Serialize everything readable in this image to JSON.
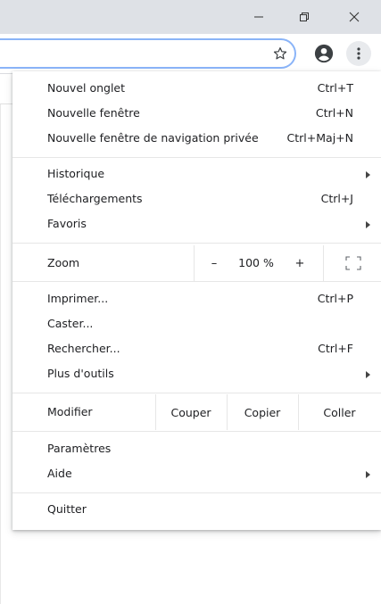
{
  "titlebar": {
    "minimize_icon": "minimize-icon",
    "restore_icon": "restore-icon",
    "close_icon": "close-icon"
  },
  "toolbar": {
    "bookmark_icon": "star-outline-icon",
    "account_icon": "account-circle-icon",
    "menu_icon": "three-dots-vertical-icon",
    "focus_color": "#8ab4f8"
  },
  "menu": {
    "new_tab": {
      "label": "Nouvel onglet",
      "shortcut": "Ctrl+T"
    },
    "new_window": {
      "label": "Nouvelle fenêtre",
      "shortcut": "Ctrl+N"
    },
    "new_incognito": {
      "label": "Nouvelle fenêtre de navigation privée",
      "shortcut": "Ctrl+Maj+N"
    },
    "history": {
      "label": "Historique"
    },
    "downloads": {
      "label": "Téléchargements",
      "shortcut": "Ctrl+J"
    },
    "bookmarks": {
      "label": "Favoris"
    },
    "zoom": {
      "label": "Zoom",
      "minus": "–",
      "value": "100 %",
      "plus": "+"
    },
    "print": {
      "label": "Imprimer...",
      "shortcut": "Ctrl+P"
    },
    "cast": {
      "label": "Caster..."
    },
    "find": {
      "label": "Rechercher...",
      "shortcut": "Ctrl+F"
    },
    "more_tools": {
      "label": "Plus d'outils"
    },
    "edit": {
      "label": "Modifier",
      "cut": "Couper",
      "copy": "Copier",
      "paste": "Coller"
    },
    "settings": {
      "label": "Paramètres"
    },
    "help": {
      "label": "Aide"
    },
    "exit": {
      "label": "Quitter"
    }
  }
}
